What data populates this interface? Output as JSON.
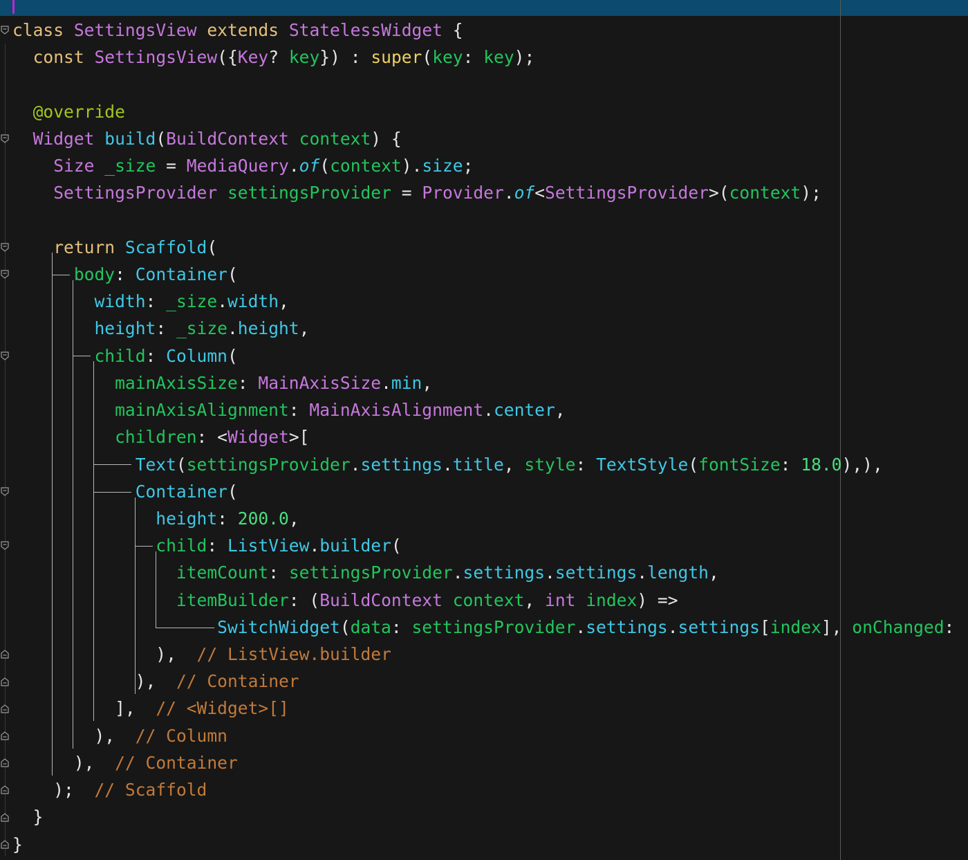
{
  "editor": {
    "language": "Dart",
    "colors": {
      "background": "#171717",
      "topbar": "#0c4a6e",
      "keyword": "#e5c07b",
      "class": "#c678dd",
      "function": "#3fc8e6",
      "property": "#22c55e",
      "comment": "#c27a3a",
      "annotation": "#a3c520"
    },
    "lines": [
      "class SettingsView extends StatelessWidget {",
      "  const SettingsView({Key? key}) : super(key: key);",
      "",
      "  @override",
      "  Widget build(BuildContext context) {",
      "    Size _size = MediaQuery.of(context).size;",
      "    SettingsProvider settingsProvider = Provider.of<SettingsProvider>(context);",
      "",
      "    return Scaffold(",
      "      body: Container(",
      "        width: _size.width,",
      "        height: _size.height,",
      "        child: Column(",
      "          mainAxisSize: MainAxisSize.min,",
      "          mainAxisAlignment: MainAxisAlignment.center,",
      "          children: <Widget>[",
      "            Text(settingsProvider.settings.title, style: TextStyle(fontSize: 18.0),),",
      "            Container(",
      "              height: 200.0,",
      "              child: ListView.builder(",
      "                itemCount: settingsProvider.settings.settings.length,",
      "                itemBuilder: (BuildContext context, int index) =>",
      "                    SwitchWidget(data: settingsProvider.settings.settings[index], onChanged:",
      "              ),  // ListView.builder",
      "            ),  // Container",
      "          ],  // <Widget>[]",
      "        ),  // Column",
      "      ),  // Container",
      "    );  // Scaffold",
      "  }",
      "}"
    ]
  }
}
